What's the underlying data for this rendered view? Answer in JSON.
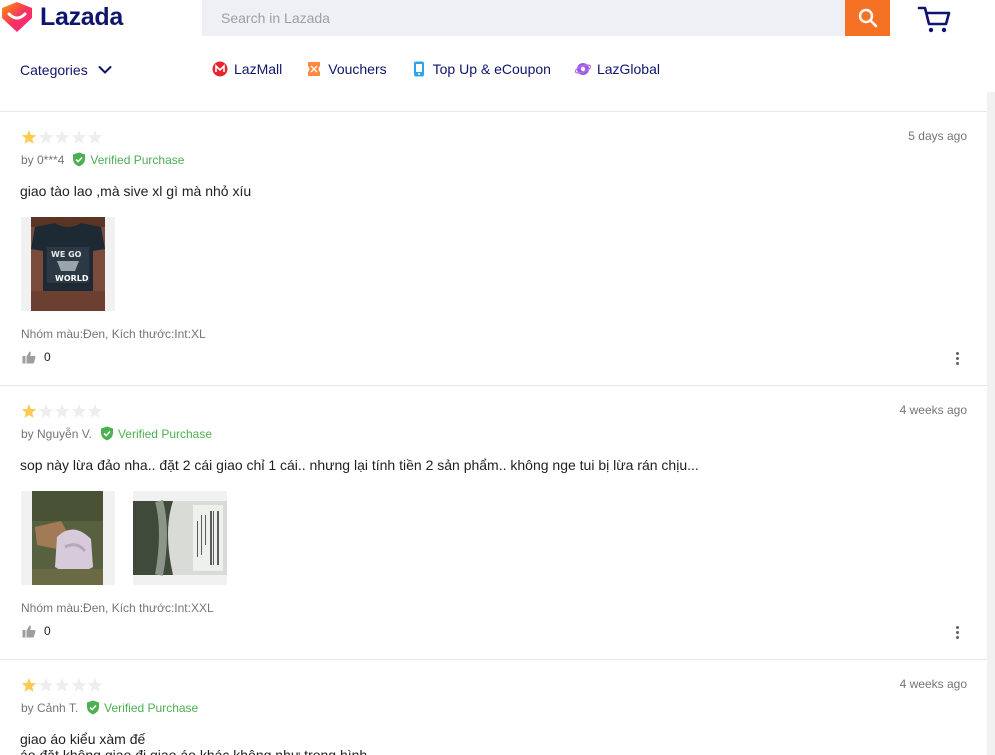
{
  "brand": {
    "name": "Lazada"
  },
  "search": {
    "placeholder": "Search in Lazada"
  },
  "nav": {
    "categories_label": "Categories",
    "links": [
      {
        "label": "LazMall",
        "icon": "lazmall-icon"
      },
      {
        "label": "Vouchers",
        "icon": "voucher-icon"
      },
      {
        "label": "Top Up & eCoupon",
        "icon": "topup-icon"
      },
      {
        "label": "LazGlobal",
        "icon": "lazglobal-icon"
      }
    ]
  },
  "colors": {
    "accent": "#f57224",
    "brand_text": "#0f146d",
    "verified": "#4caf50",
    "star_on": "#faca51",
    "star_off": "#eeeeee"
  },
  "reviews": [
    {
      "rating": 1,
      "date": "5 days ago",
      "author": "by 0***4",
      "verified": "Verified Purchase",
      "content": "giao tào lao ,mà sive xl gì mà nhỏ xíu",
      "sku": "Nhóm màu:Đen, Kích thước:Int:XL",
      "likes": "0"
    },
    {
      "rating": 1,
      "date": "4 weeks ago",
      "author": "by Nguyễn V.",
      "verified": "Verified Purchase",
      "content": "sop này lừa đảo nha.. đặt 2 cái giao chỉ 1 cái.. nhưng lại tính tiền 2 sản phẩm.. không nge tui bị lừa rán chịu...",
      "sku": "Nhóm màu:Đen, Kích thước:Int:XXL",
      "likes": "0"
    },
    {
      "rating": 1,
      "date": "4 weeks ago",
      "author": "by Cảnh T.",
      "verified": "Verified Purchase",
      "content_line1": "giao áo kiểu xàm đế",
      "content_line2": "áo đặt không giao đi giao áo khác không như trong hình"
    }
  ]
}
